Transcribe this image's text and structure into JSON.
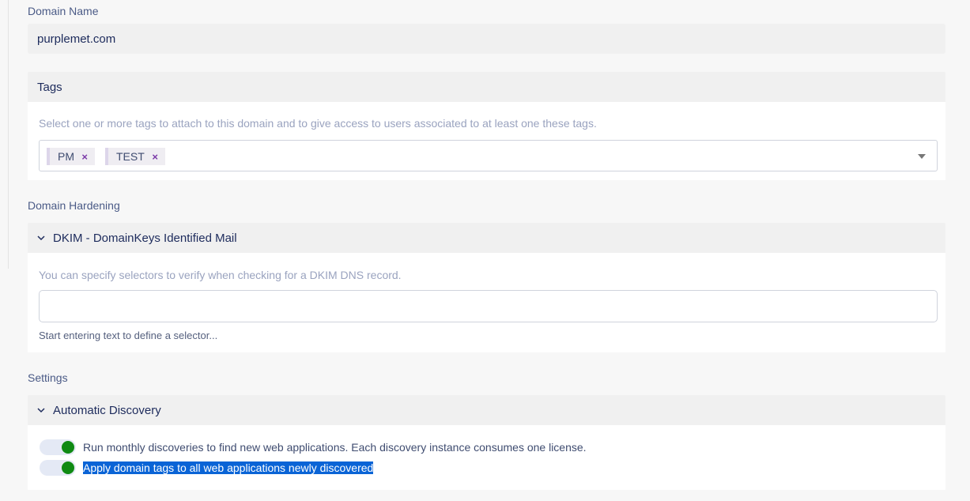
{
  "domain": {
    "label": "Domain Name",
    "value": "purplemet.com"
  },
  "tags": {
    "title": "Tags",
    "help": "Select one or more tags to attach to this domain and to give access to users associated to at least one these tags.",
    "selected": [
      "PM",
      "TEST"
    ],
    "remove_icon": "×"
  },
  "hardening": {
    "label": "Domain Hardening",
    "dkim": {
      "title": "DKIM - DomainKeys Identified Mail",
      "help": "You can specify selectors to verify when checking for a DKIM DNS record.",
      "input_value": "",
      "hint": "Start entering text to define a selector..."
    }
  },
  "settings": {
    "label": "Settings",
    "discovery": {
      "title": "Automatic Discovery",
      "toggles": [
        {
          "label": "Run monthly discoveries to find new web applications. Each discovery instance consumes one license.",
          "on": true
        },
        {
          "label": "Apply domain tags to all web applications newly discovered",
          "on": true
        }
      ]
    }
  },
  "icons": {
    "chevron": "chevron-down-icon",
    "dropdown": "caret-down-icon",
    "toggle_on_color": "#0f8a13"
  }
}
